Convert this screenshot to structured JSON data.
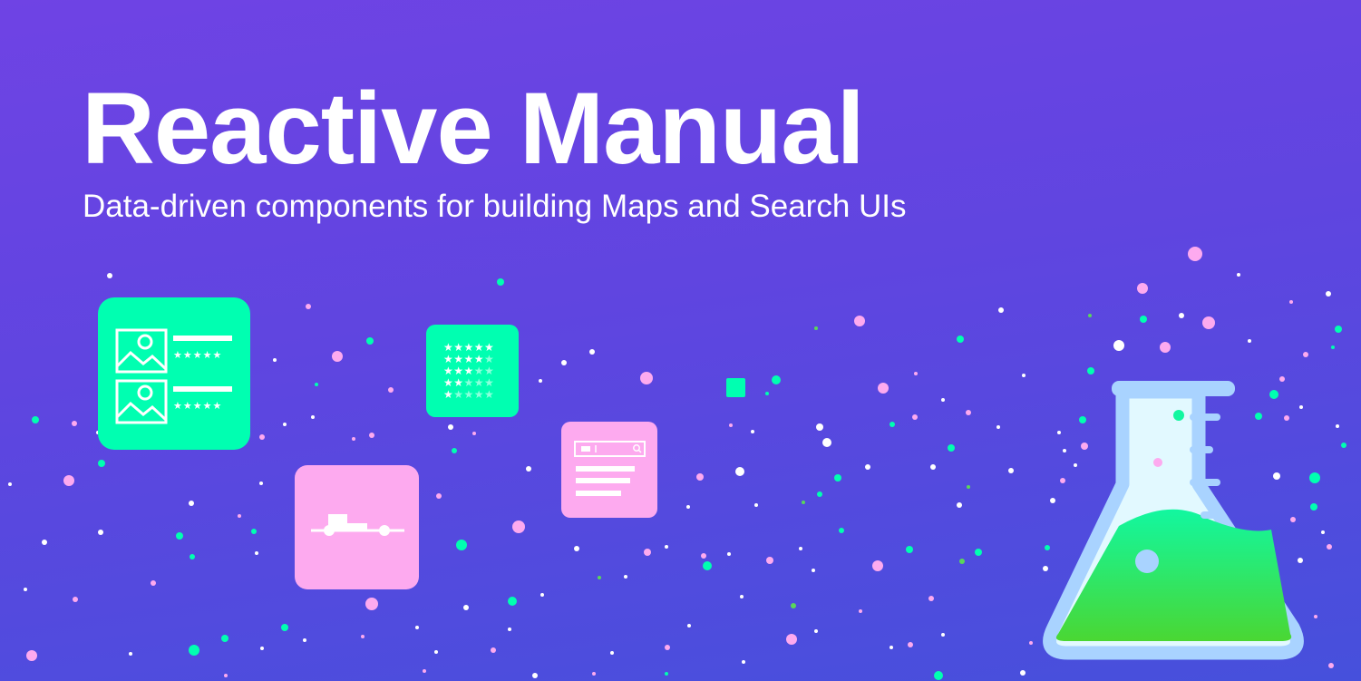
{
  "banner": {
    "title": "Reactive Manual",
    "subtitle": "Data-driven components for building Maps and Search UIs"
  },
  "colors": {
    "background_top": "#6f43e4",
    "background_bottom": "#4650dc",
    "text": "#ffffff",
    "mint": "#00ffb1",
    "pink": "#fdaaef",
    "flask_outline": "#a9d3ff",
    "flask_glass": "#e2f9ff",
    "liquid_top": "#12f7a0",
    "liquid_bottom": "#4ad733"
  },
  "icons": [
    "result-list-icon",
    "star-rating-icon",
    "range-slider-icon",
    "search-list-icon",
    "flask-icon"
  ]
}
